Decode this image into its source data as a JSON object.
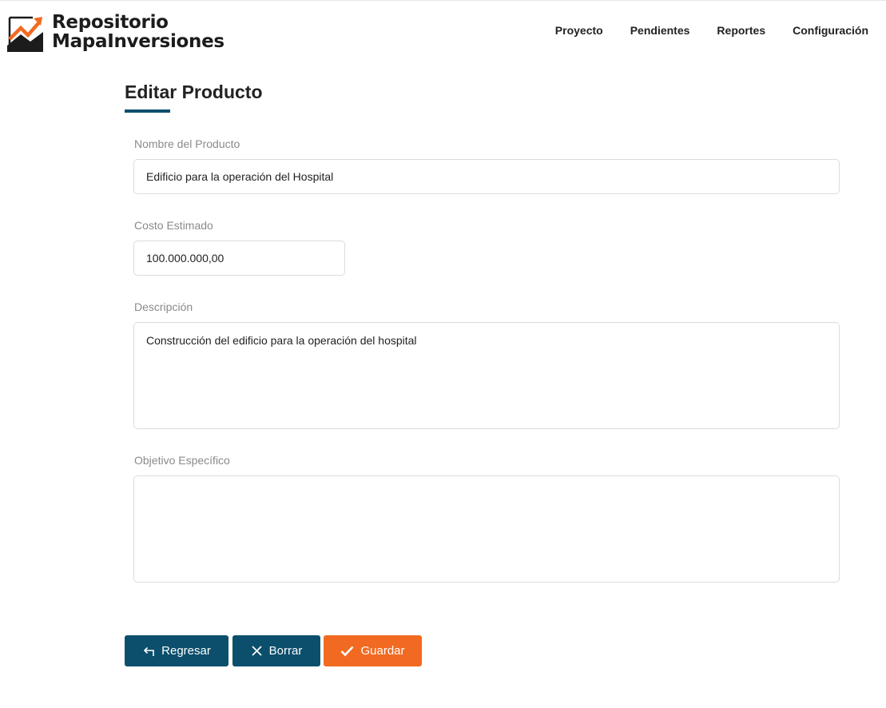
{
  "brand": {
    "line1": "Repositorio",
    "line2": "MapaInversiones",
    "colors": {
      "dark": "#1c1c1c",
      "accent": "#f26a21"
    }
  },
  "nav": {
    "items": [
      {
        "label": "Proyecto"
      },
      {
        "label": "Pendientes"
      },
      {
        "label": "Reportes"
      },
      {
        "label": "Configuración"
      }
    ]
  },
  "page": {
    "title": "Editar Producto"
  },
  "form": {
    "nombre": {
      "label": "Nombre del Producto",
      "value": "Edificio para la operación del Hospital"
    },
    "costo": {
      "label": "Costo Estimado",
      "value": "100.000.000,00"
    },
    "descripcion": {
      "label": "Descripción",
      "value": "Construcción del edificio para la operación del hospital"
    },
    "objetivo": {
      "label": "Objetivo Específico",
      "value": ""
    }
  },
  "actions": {
    "back": {
      "label": "Regresar",
      "icon": "return-arrow-icon"
    },
    "delete": {
      "label": "Borrar",
      "icon": "close-icon"
    },
    "save": {
      "label": "Guardar",
      "icon": "checkmark-icon"
    }
  },
  "colors": {
    "primary": "#0b4f6c",
    "accent": "#f26a21",
    "label": "#8a8a8a",
    "border": "#dcdcdc"
  }
}
